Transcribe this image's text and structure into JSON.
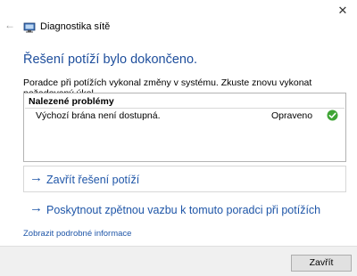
{
  "window": {
    "title": "Diagnostika sítě",
    "back_glyph": "←",
    "close_glyph": "✕"
  },
  "main": {
    "heading": "Řešení potíží bylo dokončeno.",
    "description": "Poradce při potížích vykonal změny v systému. Zkuste znovu vykonat požadovaný úkol.",
    "problems": {
      "header": "Nalezené problémy",
      "items": [
        {
          "name": "Výchozí brána není dostupná.",
          "status": "Opraveno",
          "status_icon": "green-check-icon"
        }
      ]
    },
    "links": [
      {
        "arrow": "→",
        "label": "Zavřít řešení potíží"
      },
      {
        "arrow": "→",
        "label": "Poskytnout zpětnou vazbu k tomuto poradci při potížích"
      }
    ],
    "details_link": "Zobrazit podrobné informace"
  },
  "footer": {
    "close_label": "Zavřít"
  },
  "colors": {
    "heading": "#1e4e9c",
    "link": "#1f56a8",
    "success": "#3fa535"
  }
}
